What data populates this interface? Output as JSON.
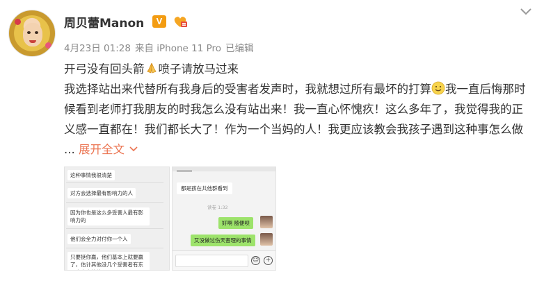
{
  "post": {
    "username": "周贝蕾Manon",
    "verified_badge": "V",
    "fan_badge_icon": "fan-badge-icon",
    "meta": {
      "date": "4月23日 01:28",
      "source": "来自 iPhone 11 Pro",
      "edited": "已编辑"
    },
    "line1_a": "开弓没有回头箭",
    "line1_b": "喷子请放马过来",
    "body_a": "我选择站出来代替所有我身后的受害者发声时，我就想过所有最坏的打算",
    "body_b": "我一直后悔那时候看到老师打我朋友的时我怎么没有站出来！我一直心怀愧疚！这么多年了，我觉得我的正义感一直都在！我们都长大了！作为一个当妈的人！我更应该教会我孩子遇到这种事怎么做 ... ",
    "expand_label": "展开全文",
    "accent_color": "#eb7350"
  },
  "images": {
    "left": {
      "messages": [
        "这种事情我很清楚",
        "对方会选择最有影响力的人",
        "因为你也是这么多受害人最有影响力的",
        "他们会全力对付你一个人",
        "只要挺你赢，他们基本上就要赢了，估计其他没几个受害者有东西出来也比较弱了"
      ]
    },
    "right": {
      "incoming": "都是孩在共他群看到",
      "timestamp": "读卷 1:32",
      "outgoing": [
        "好啊 随便呗",
        "又没做过伤天害理的事情"
      ]
    }
  }
}
